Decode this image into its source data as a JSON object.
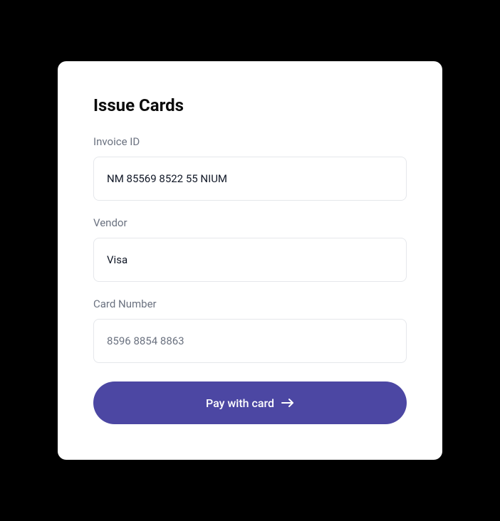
{
  "title": "Issue Cards",
  "fields": {
    "invoice_id": {
      "label": "Invoice ID",
      "value": "NM 85569 8522 55 NIUM"
    },
    "vendor": {
      "label": "Vendor",
      "value": "Visa"
    },
    "card_number": {
      "label": "Card Number",
      "value": "8596 8854 8863"
    }
  },
  "actions": {
    "pay_label": "Pay with card"
  },
  "colors": {
    "primary": "#4c47a3"
  }
}
